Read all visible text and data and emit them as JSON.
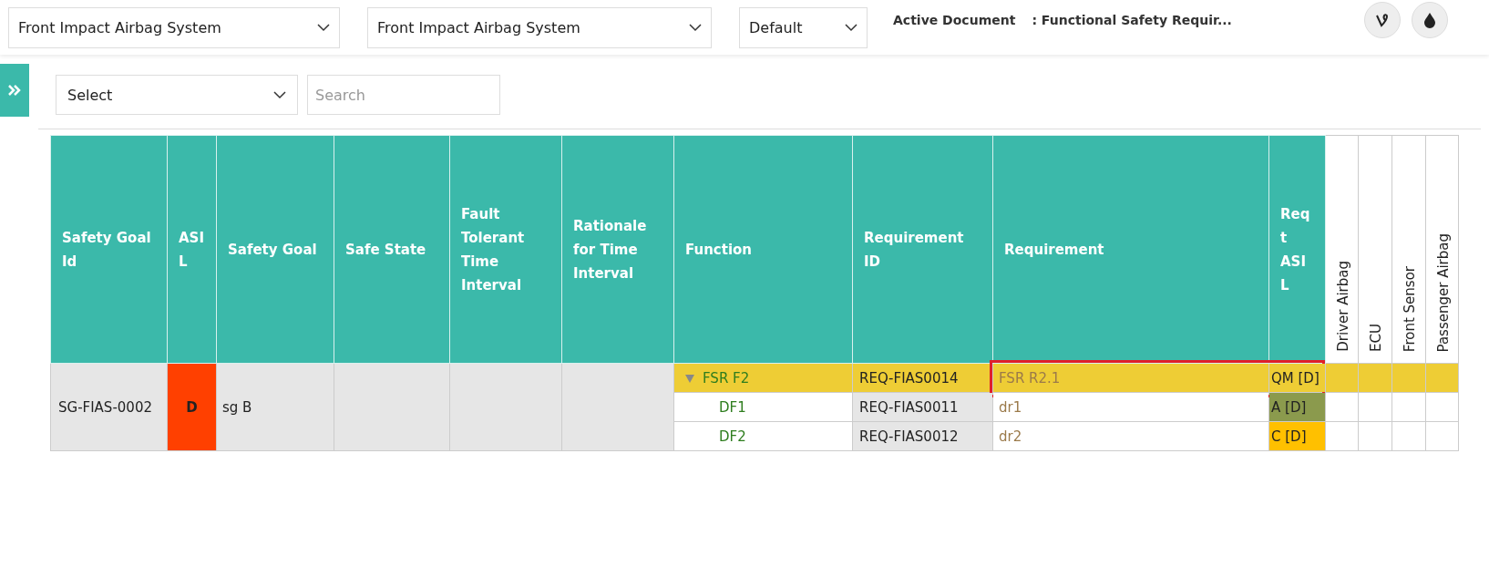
{
  "header": {
    "focus_element": {
      "value": "Front Impact Airbag System"
    },
    "context_element": {
      "value": "Front Impact Airbag System"
    },
    "format": {
      "value": "Default"
    },
    "active_document": {
      "label": "Active Document",
      "value": ": Functional Safety Requir..."
    }
  },
  "toolbar": {
    "sidebar_expanded": false,
    "filter": {
      "value": "Select"
    },
    "search": {
      "placeholder": "Search"
    }
  },
  "table": {
    "columns": [
      {
        "label": "Safety Goal Id",
        "kind": "horizontal"
      },
      {
        "label": "ASIL",
        "kind": "horizontal"
      },
      {
        "label": "Safety Goal",
        "kind": "horizontal"
      },
      {
        "label": "Safe State",
        "kind": "horizontal"
      },
      {
        "label": "Fault Tolerant Time Interval",
        "kind": "horizontal"
      },
      {
        "label": "Rationale for Time Interval",
        "kind": "horizontal"
      },
      {
        "label": "Function",
        "kind": "horizontal"
      },
      {
        "label": "Requirement ID",
        "kind": "horizontal"
      },
      {
        "label": "Requirement",
        "kind": "horizontal"
      },
      {
        "label": "Reqt ASIL",
        "kind": "horizontal"
      },
      {
        "label": "Driver Airbag",
        "kind": "vertical"
      },
      {
        "label": "ECU",
        "kind": "vertical"
      },
      {
        "label": "Front Sensor",
        "kind": "vertical"
      },
      {
        "label": "Passenger Airbag",
        "kind": "vertical"
      }
    ],
    "goal": {
      "id": "SG-FIAS-0002",
      "asil": "D",
      "name": "sg B"
    },
    "functions": [
      {
        "function": "FSR F2",
        "expanded": true,
        "selected": true,
        "highlighted": true,
        "requirement_id": "REQ-FIAS0014",
        "requirement": "FSR R2.1",
        "reqt_asil": "QM [D]",
        "color": "#eecd35",
        "children": [
          {
            "function": "DF1",
            "selected": false,
            "highlighted": false,
            "requirement_id": "REQ-FIAS0011",
            "requirement": "dr1",
            "reqt_asil": "A [D]",
            "color": "#8b9a4d"
          },
          {
            "function": "DF2",
            "selected": false,
            "highlighted": false,
            "requirement_id": "REQ-FIAS0012",
            "requirement": "dr2",
            "reqt_asil": "C [D]",
            "color": "#ffc000"
          }
        ]
      }
    ]
  }
}
